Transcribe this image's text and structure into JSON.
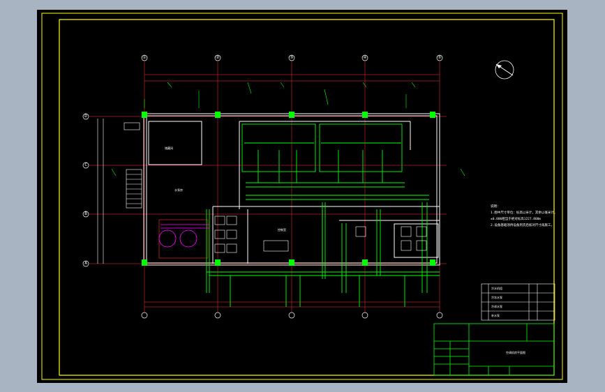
{
  "drawing": {
    "title_block_name": "空调机房平面图",
    "north_arrow": "north-arrow",
    "axes_columns": [
      "①",
      "②",
      "③",
      "④",
      "⑤"
    ],
    "axes_rows": [
      "D",
      "C",
      "B",
      "A"
    ],
    "rooms": {
      "storage": "储藏间",
      "main_room": "水泵房",
      "control_room": "控制室"
    },
    "notes": {
      "heading": "说明：",
      "items": [
        "1.图中尺寸单位：标高以米计，其余以毫米计。",
        "±0.000相当于绝对标高1227.800m",
        "2.设备基础须待设备到货后核对尺寸再施工。"
      ]
    },
    "equipment_table_rows": [
      "冷水机组",
      "冷冻水泵",
      "冷却水泵",
      "补水泵"
    ],
    "colors": {
      "background": "#000000",
      "frame": "#ffff00",
      "walls": "#ffffff",
      "grid": "#ff0000",
      "pipes": "#00ff00",
      "columns": "#00ff00",
      "equipment": "#ff00ff"
    }
  }
}
